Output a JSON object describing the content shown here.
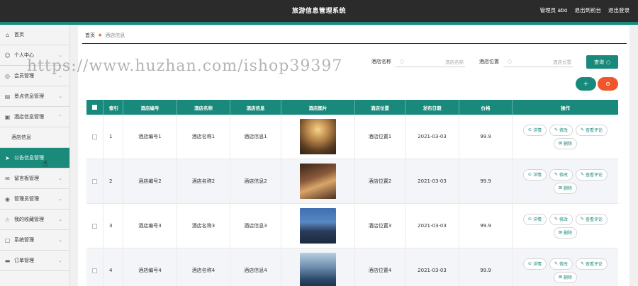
{
  "header": {
    "title": "旅游信息管理系统",
    "user": "管理员 abo",
    "to_frontend": "退出到前台",
    "logout": "退出登录"
  },
  "sidebar": {
    "items": [
      {
        "label": "首页",
        "icon": "home-icon",
        "expandable": false
      },
      {
        "label": "个人中心",
        "icon": "user-icon",
        "expandable": true
      },
      {
        "label": "会员管理",
        "icon": "member-icon",
        "expandable": true
      },
      {
        "label": "景点信息管理",
        "icon": "document-icon",
        "expandable": true
      },
      {
        "label": "酒店信息管理",
        "icon": "hotel-icon",
        "expandable": true,
        "expanded": true
      },
      {
        "label": "酒店信息",
        "icon": "",
        "sub": true
      },
      {
        "label": "公告信息管理",
        "icon": "send-icon",
        "expandable": true,
        "active": true
      },
      {
        "label": "留言板管理",
        "icon": "mail-icon",
        "expandable": true
      },
      {
        "label": "管理员管理",
        "icon": "admin-icon",
        "expandable": true
      },
      {
        "label": "我的收藏管理",
        "icon": "star-icon",
        "expandable": true
      },
      {
        "label": "系统管理",
        "icon": "settings-icon",
        "expandable": true
      },
      {
        "label": "订单管理",
        "icon": "order-icon",
        "expandable": true
      }
    ]
  },
  "breadcrumb": {
    "home": "首页",
    "current": "酒店信息"
  },
  "search": {
    "name_label": "酒店名称",
    "name_placeholder": "酒店名称",
    "location_label": "酒店位置",
    "location_placeholder": "酒店位置",
    "query_button": "查询"
  },
  "actions": {
    "add": "+",
    "delete": "⊖"
  },
  "watermark": "https://www.huzhan.com/ishop39397",
  "table": {
    "columns": [
      "索引",
      "酒店编号",
      "酒店名称",
      "酒店信息",
      "酒店图片",
      "酒店位置",
      "发布日期",
      "价格",
      "操作"
    ],
    "op_labels": {
      "detail": "详情",
      "edit": "修改",
      "review": "查看评论",
      "delete": "删除"
    },
    "rows": [
      {
        "index": "1",
        "no": "酒店编号1",
        "name": "酒店名称1",
        "info": "酒店信息1",
        "location": "酒店位置1",
        "date": "2021-03-03",
        "price": "99.9"
      },
      {
        "index": "2",
        "no": "酒店编号2",
        "name": "酒店名称2",
        "info": "酒店信息2",
        "location": "酒店位置2",
        "date": "2021-03-03",
        "price": "99.9"
      },
      {
        "index": "3",
        "no": "酒店编号3",
        "name": "酒店名称3",
        "info": "酒店信息3",
        "location": "酒店位置3",
        "date": "2021-03-03",
        "price": "99.9"
      },
      {
        "index": "4",
        "no": "酒店编号4",
        "name": "酒店名称4",
        "info": "酒店信息4",
        "location": "酒店位置4",
        "date": "2021-03-03",
        "price": "99.9"
      }
    ]
  },
  "colors": {
    "accent": "#18897a",
    "danger": "#f0552b",
    "topbar": "#2b2b2b"
  }
}
